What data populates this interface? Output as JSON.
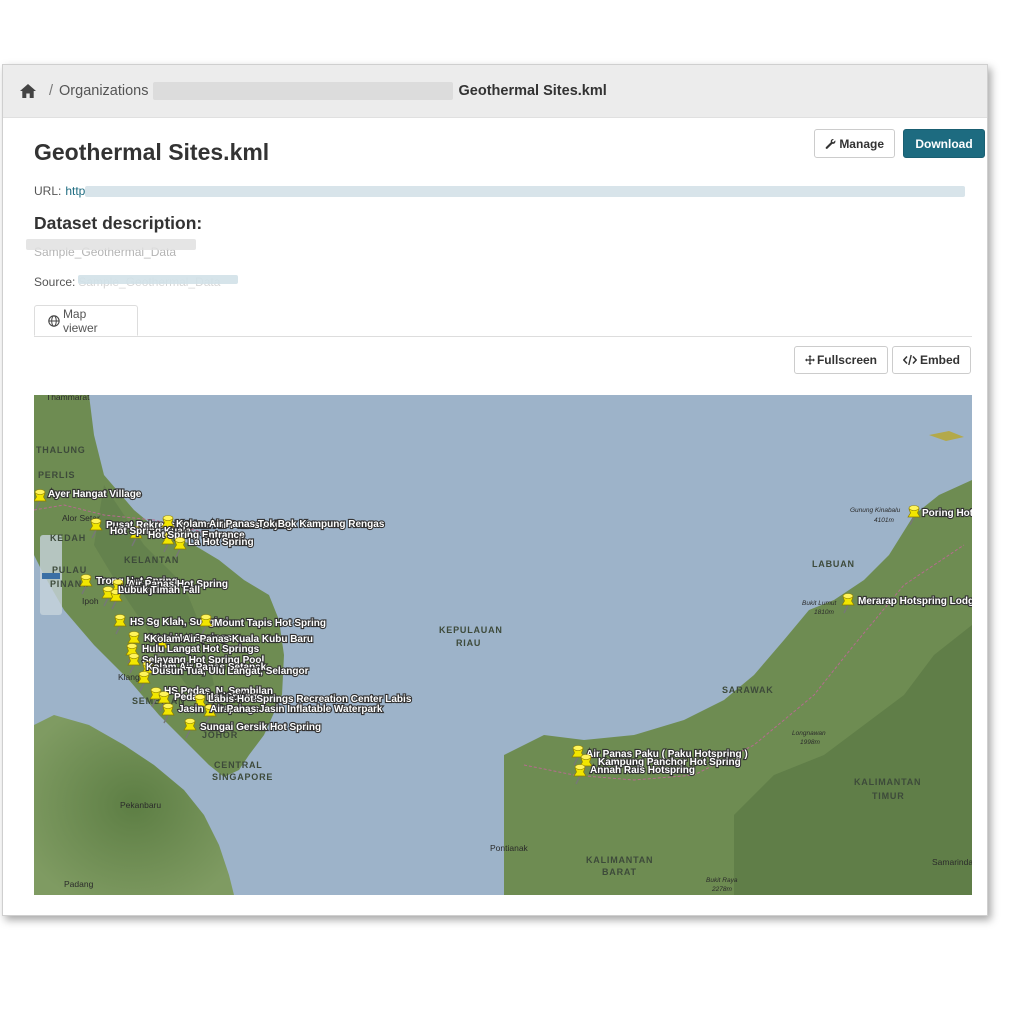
{
  "breadcrumb": {
    "home_icon": "home-icon",
    "organizations": "Organizations",
    "separator": "/",
    "current": "Geothermal Sites.kml"
  },
  "page": {
    "title": "Geothermal Sites.kml",
    "manage_label": "Manage",
    "download_label": "Download",
    "url_label": "URL:",
    "url_value": "http",
    "description_heading": "Dataset description:",
    "description_text": "Sample_Geothermal_Data",
    "source_label": "Source:",
    "source_value": "Sample_Geothermal_Data"
  },
  "tabs": {
    "map_viewer": "Map viewer"
  },
  "map_actions": {
    "fullscreen_label": "Fullscreen",
    "embed_label": "Embed"
  },
  "colors": {
    "accent": "#1d6b80",
    "pin": "#f2e600",
    "sea": "#9db3c9",
    "land": "#6e8c52"
  },
  "map": {
    "place_labels": [
      "Thammarat",
      "THALUNG",
      "PERLIS",
      "Alor Setar",
      "KEDAH",
      "PULAU",
      "PINANG",
      "Ipoh",
      "KELANTAN",
      "Kuala",
      "KEPULAUAN",
      "RIAU",
      "Klang",
      "SEMBILAN",
      "JOHOR",
      "CENTRAL",
      "SINGAPORE",
      "Pekanbaru",
      "Padang",
      "LABUAN",
      "SARAWAK",
      "KALIMANTAN",
      "TIMUR",
      "BARAT",
      "Pontianak",
      "Samarinda"
    ],
    "peak_labels": [
      "Gunung Kinabalu",
      "4101m",
      "Bukit Lumut",
      "1810m",
      "Longnawan",
      "1998m",
      "Bukit Raya",
      "2278m"
    ],
    "hotspring_labels": [
      "Ayer Hangat Village",
      "Pusat Rekreasi Kolam Air Panas Lojing",
      "Kolam Air Panas Tok Bok Kampung Rengas",
      "Hot Spring Kuala",
      "Hot Spring Entrance",
      "La Hot Spring",
      "Trong Hot Spring",
      "Air Panas Hot Spring",
      "Air Terjun",
      "Lubuk Timah Fall",
      "HS Sg Klah, Sungkai",
      "Mount Tapis Hot Spring",
      "Ketari Hot Springs",
      "Kolam Air Panas Kuala Kubu Baru",
      "Hulu Langat Hot Springs",
      "Selayang Hot Spring Pool",
      "Kolam Air Panas Setapak",
      "Dusun Tua, Ulu Langat, Selangor",
      "HS Pedas, N. Sembilan",
      "Pedas Hot Springs",
      "Labis Hot Springs Recreation Center Labis",
      "Jasin Hotsprings",
      "Air Panas Jasin Inflatable Waterpark",
      "Sungai Gersik Hot Spring",
      "Air Panas Paku ( Paku Hotspring )",
      "Kampung Panchor Hot Spring",
      "Annah Rais Hotspring",
      "Poring Hot Spring",
      "Merarap Hotspring Lodge"
    ]
  }
}
